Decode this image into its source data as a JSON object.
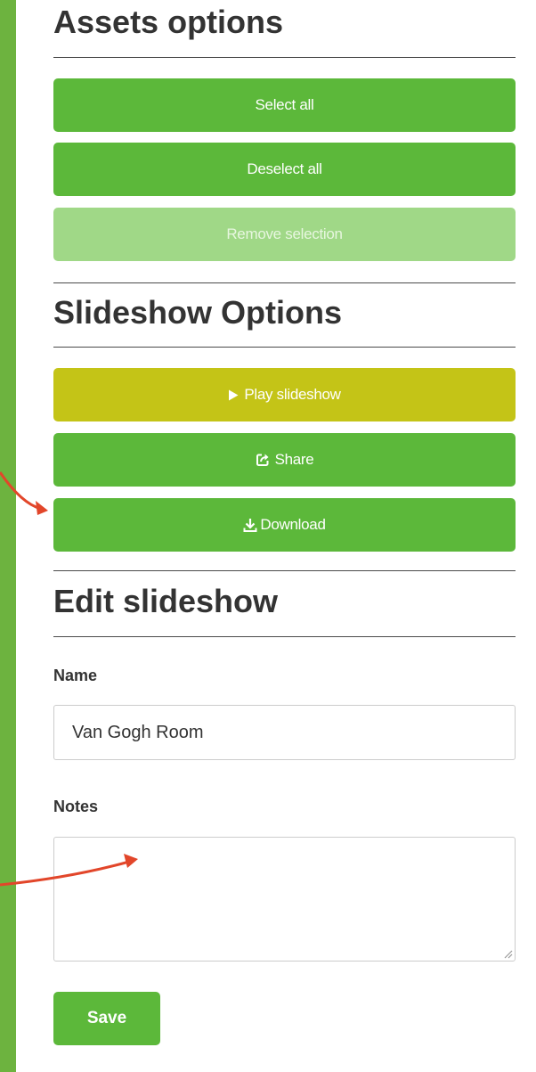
{
  "colors": {
    "outer_background": "#6db33f",
    "button_green": "#5cb83a",
    "button_disabled": "#a0d887",
    "button_play": "#c4c417",
    "annotation_arrow": "#e2462a"
  },
  "assets_options": {
    "title": "Assets options",
    "select_all": "Select all",
    "deselect_all": "Deselect all",
    "remove_selection": "Remove selection",
    "remove_selection_disabled": true
  },
  "slideshow_options": {
    "title": "Slideshow Options",
    "play": "Play slideshow",
    "play_icon": "play-icon",
    "share": "Share",
    "share_icon": "share-icon",
    "download": "Download",
    "download_icon": "download-icon"
  },
  "edit_slideshow": {
    "title": "Edit slideshow",
    "name_label": "Name",
    "name_value": "Van Gogh Room",
    "notes_label": "Notes",
    "notes_value": "",
    "save": "Save"
  }
}
